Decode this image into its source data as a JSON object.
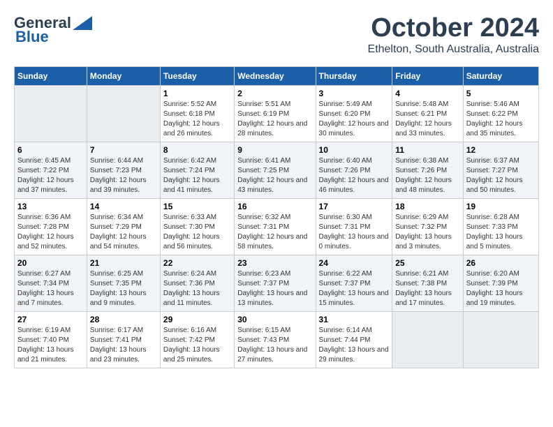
{
  "header": {
    "logo_general": "General",
    "logo_blue": "Blue",
    "month_title": "October 2024",
    "location": "Ethelton, South Australia, Australia"
  },
  "days_of_week": [
    "Sunday",
    "Monday",
    "Tuesday",
    "Wednesday",
    "Thursday",
    "Friday",
    "Saturday"
  ],
  "weeks": [
    [
      {
        "day": "",
        "sunrise": "",
        "sunset": "",
        "daylight": ""
      },
      {
        "day": "",
        "sunrise": "",
        "sunset": "",
        "daylight": ""
      },
      {
        "day": "1",
        "sunrise": "Sunrise: 5:52 AM",
        "sunset": "Sunset: 6:18 PM",
        "daylight": "Daylight: 12 hours and 26 minutes."
      },
      {
        "day": "2",
        "sunrise": "Sunrise: 5:51 AM",
        "sunset": "Sunset: 6:19 PM",
        "daylight": "Daylight: 12 hours and 28 minutes."
      },
      {
        "day": "3",
        "sunrise": "Sunrise: 5:49 AM",
        "sunset": "Sunset: 6:20 PM",
        "daylight": "Daylight: 12 hours and 30 minutes."
      },
      {
        "day": "4",
        "sunrise": "Sunrise: 5:48 AM",
        "sunset": "Sunset: 6:21 PM",
        "daylight": "Daylight: 12 hours and 33 minutes."
      },
      {
        "day": "5",
        "sunrise": "Sunrise: 5:46 AM",
        "sunset": "Sunset: 6:22 PM",
        "daylight": "Daylight: 12 hours and 35 minutes."
      }
    ],
    [
      {
        "day": "6",
        "sunrise": "Sunrise: 6:45 AM",
        "sunset": "Sunset: 7:22 PM",
        "daylight": "Daylight: 12 hours and 37 minutes."
      },
      {
        "day": "7",
        "sunrise": "Sunrise: 6:44 AM",
        "sunset": "Sunset: 7:23 PM",
        "daylight": "Daylight: 12 hours and 39 minutes."
      },
      {
        "day": "8",
        "sunrise": "Sunrise: 6:42 AM",
        "sunset": "Sunset: 7:24 PM",
        "daylight": "Daylight: 12 hours and 41 minutes."
      },
      {
        "day": "9",
        "sunrise": "Sunrise: 6:41 AM",
        "sunset": "Sunset: 7:25 PM",
        "daylight": "Daylight: 12 hours and 43 minutes."
      },
      {
        "day": "10",
        "sunrise": "Sunrise: 6:40 AM",
        "sunset": "Sunset: 7:26 PM",
        "daylight": "Daylight: 12 hours and 46 minutes."
      },
      {
        "day": "11",
        "sunrise": "Sunrise: 6:38 AM",
        "sunset": "Sunset: 7:26 PM",
        "daylight": "Daylight: 12 hours and 48 minutes."
      },
      {
        "day": "12",
        "sunrise": "Sunrise: 6:37 AM",
        "sunset": "Sunset: 7:27 PM",
        "daylight": "Daylight: 12 hours and 50 minutes."
      }
    ],
    [
      {
        "day": "13",
        "sunrise": "Sunrise: 6:36 AM",
        "sunset": "Sunset: 7:28 PM",
        "daylight": "Daylight: 12 hours and 52 minutes."
      },
      {
        "day": "14",
        "sunrise": "Sunrise: 6:34 AM",
        "sunset": "Sunset: 7:29 PM",
        "daylight": "Daylight: 12 hours and 54 minutes."
      },
      {
        "day": "15",
        "sunrise": "Sunrise: 6:33 AM",
        "sunset": "Sunset: 7:30 PM",
        "daylight": "Daylight: 12 hours and 56 minutes."
      },
      {
        "day": "16",
        "sunrise": "Sunrise: 6:32 AM",
        "sunset": "Sunset: 7:31 PM",
        "daylight": "Daylight: 12 hours and 58 minutes."
      },
      {
        "day": "17",
        "sunrise": "Sunrise: 6:30 AM",
        "sunset": "Sunset: 7:31 PM",
        "daylight": "Daylight: 13 hours and 0 minutes."
      },
      {
        "day": "18",
        "sunrise": "Sunrise: 6:29 AM",
        "sunset": "Sunset: 7:32 PM",
        "daylight": "Daylight: 13 hours and 3 minutes."
      },
      {
        "day": "19",
        "sunrise": "Sunrise: 6:28 AM",
        "sunset": "Sunset: 7:33 PM",
        "daylight": "Daylight: 13 hours and 5 minutes."
      }
    ],
    [
      {
        "day": "20",
        "sunrise": "Sunrise: 6:27 AM",
        "sunset": "Sunset: 7:34 PM",
        "daylight": "Daylight: 13 hours and 7 minutes."
      },
      {
        "day": "21",
        "sunrise": "Sunrise: 6:25 AM",
        "sunset": "Sunset: 7:35 PM",
        "daylight": "Daylight: 13 hours and 9 minutes."
      },
      {
        "day": "22",
        "sunrise": "Sunrise: 6:24 AM",
        "sunset": "Sunset: 7:36 PM",
        "daylight": "Daylight: 13 hours and 11 minutes."
      },
      {
        "day": "23",
        "sunrise": "Sunrise: 6:23 AM",
        "sunset": "Sunset: 7:37 PM",
        "daylight": "Daylight: 13 hours and 13 minutes."
      },
      {
        "day": "24",
        "sunrise": "Sunrise: 6:22 AM",
        "sunset": "Sunset: 7:37 PM",
        "daylight": "Daylight: 13 hours and 15 minutes."
      },
      {
        "day": "25",
        "sunrise": "Sunrise: 6:21 AM",
        "sunset": "Sunset: 7:38 PM",
        "daylight": "Daylight: 13 hours and 17 minutes."
      },
      {
        "day": "26",
        "sunrise": "Sunrise: 6:20 AM",
        "sunset": "Sunset: 7:39 PM",
        "daylight": "Daylight: 13 hours and 19 minutes."
      }
    ],
    [
      {
        "day": "27",
        "sunrise": "Sunrise: 6:19 AM",
        "sunset": "Sunset: 7:40 PM",
        "daylight": "Daylight: 13 hours and 21 minutes."
      },
      {
        "day": "28",
        "sunrise": "Sunrise: 6:17 AM",
        "sunset": "Sunset: 7:41 PM",
        "daylight": "Daylight: 13 hours and 23 minutes."
      },
      {
        "day": "29",
        "sunrise": "Sunrise: 6:16 AM",
        "sunset": "Sunset: 7:42 PM",
        "daylight": "Daylight: 13 hours and 25 minutes."
      },
      {
        "day": "30",
        "sunrise": "Sunrise: 6:15 AM",
        "sunset": "Sunset: 7:43 PM",
        "daylight": "Daylight: 13 hours and 27 minutes."
      },
      {
        "day": "31",
        "sunrise": "Sunrise: 6:14 AM",
        "sunset": "Sunset: 7:44 PM",
        "daylight": "Daylight: 13 hours and 29 minutes."
      },
      {
        "day": "",
        "sunrise": "",
        "sunset": "",
        "daylight": ""
      },
      {
        "day": "",
        "sunrise": "",
        "sunset": "",
        "daylight": ""
      }
    ]
  ]
}
